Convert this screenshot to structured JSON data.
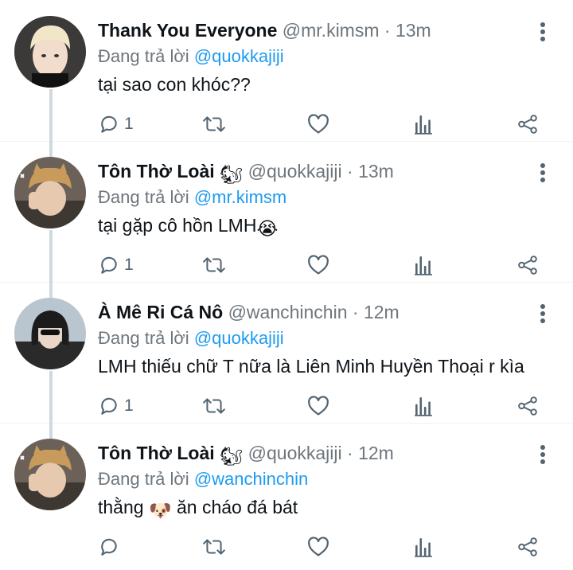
{
  "reply_prefix": "Đang trả lời",
  "tweets": [
    {
      "name": "Thank You Everyone",
      "name_emoji": "",
      "handle": "@mr.kimsm",
      "time": "13m",
      "reply_to": "@quokkajiji",
      "text": "tại sao con khóc??",
      "text_emoji": "",
      "text_after": "",
      "reply_count": "1",
      "avatar_bg": "#d9d4cc",
      "avatar_hair": "#f1e7c8"
    },
    {
      "name": "Tôn Thờ Loài",
      "name_emoji": "🐿",
      "handle": "@quokkajiji",
      "time": "13m",
      "reply_to": "@mr.kimsm",
      "text": "tại gặp cô hồn LMH",
      "text_emoji": "😭",
      "text_after": "",
      "reply_count": "1",
      "avatar_bg": "#6b6158",
      "avatar_hair": "#c89a5b"
    },
    {
      "name": "À Mê Ri Cá Nô",
      "name_emoji": "",
      "handle": "@wanchinchin",
      "time": "12m",
      "reply_to": "@quokkajiji",
      "text": "LMH thiếu chữ T nữa là Liên Minh Huyền Thoại r kìa",
      "text_emoji": "",
      "text_after": "",
      "reply_count": "1",
      "avatar_bg": "#b9c6cf",
      "avatar_hair": "#1c1c1c"
    },
    {
      "name": "Tôn Thờ Loài",
      "name_emoji": "🐿",
      "handle": "@quokkajiji",
      "time": "12m",
      "reply_to": "@wanchinchin",
      "text": "thằng ",
      "text_emoji": "🐶",
      "text_after": " ăn cháo đá bát",
      "reply_count": "",
      "avatar_bg": "#6b6158",
      "avatar_hair": "#c89a5b"
    }
  ],
  "colors": {
    "mention": "#1d9bf0",
    "muted": "#6e767d",
    "icon": "#536471"
  },
  "icons": [
    "reply-icon",
    "retweet-icon",
    "like-icon",
    "analytics-icon",
    "share-icon",
    "more-icon"
  ]
}
